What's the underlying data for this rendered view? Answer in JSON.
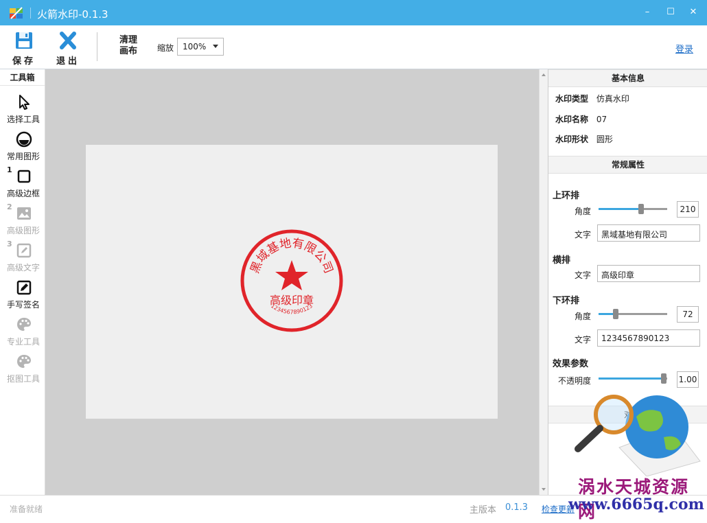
{
  "window": {
    "title": "火箭水印-0.1.3",
    "minimize": "–",
    "maximize": "☐",
    "close": "✕"
  },
  "toolbar": {
    "save_label": "保存",
    "exit_label": "退出",
    "clear_line1": "清理",
    "clear_line2": "画布",
    "zoom_label": "缩放",
    "zoom_value": "100%",
    "login_label": "登录"
  },
  "sidebar": {
    "title": "工具箱",
    "tools": [
      {
        "label": "选择工具",
        "icon": "cursor-icon",
        "enabled": true,
        "num": ""
      },
      {
        "label": "常用图形",
        "icon": "shape-icon",
        "enabled": true,
        "num": ""
      },
      {
        "label": "高级边框",
        "icon": "square-icon",
        "enabled": true,
        "num": "1"
      },
      {
        "label": "高级图形",
        "icon": "image-icon",
        "enabled": false,
        "num": "2"
      },
      {
        "label": "高级文字",
        "icon": "edit-icon",
        "enabled": false,
        "num": "3"
      },
      {
        "label": "手写签名",
        "icon": "signature-icon",
        "enabled": true,
        "num": ""
      },
      {
        "label": "专业工具",
        "icon": "palette-icon",
        "enabled": false,
        "num": ""
      },
      {
        "label": "抠图工具",
        "icon": "palette-icon",
        "enabled": false,
        "num": ""
      }
    ]
  },
  "canvas": {
    "stamp": {
      "ring_text": "黑域基地有限公司",
      "center_text": "高级印章",
      "bottom_text": "1234567890123"
    }
  },
  "panel": {
    "basic_title": "基本信息",
    "type_key": "水印类型",
    "type_value": "仿真水印",
    "name_key": "水印名称",
    "name_value": "07",
    "shape_key": "水印形状",
    "shape_value": "圆形",
    "general_title": "常规属性",
    "upper_title": "上环排",
    "angle_label": "角度",
    "text_label": "文字",
    "upper_angle": "210",
    "upper_angle_fraction": 0.62,
    "upper_text": "黑域基地有限公司",
    "horizontal_title": "横排",
    "horizontal_text": "高级印章",
    "lower_title": "下环排",
    "lower_angle": "72",
    "lower_angle_fraction": 0.25,
    "lower_text": "1234567890123",
    "effect_title": "效果参数",
    "opacity_label": "不透明度",
    "opacity_value": "1.00",
    "opacity_fraction": 0.95,
    "bottom_button": "对"
  },
  "status": {
    "ready": "准备就绪",
    "version_label": "主版本",
    "version_value": "0.1.3",
    "check_update": "检查更新"
  },
  "watermark": {
    "site_name": "涡水天城资源网",
    "site_url": "www.6665q.com"
  },
  "colors": {
    "titlebar": "#43aee6",
    "accent": "#3ba6df",
    "stamp_red": "#e0242a"
  }
}
